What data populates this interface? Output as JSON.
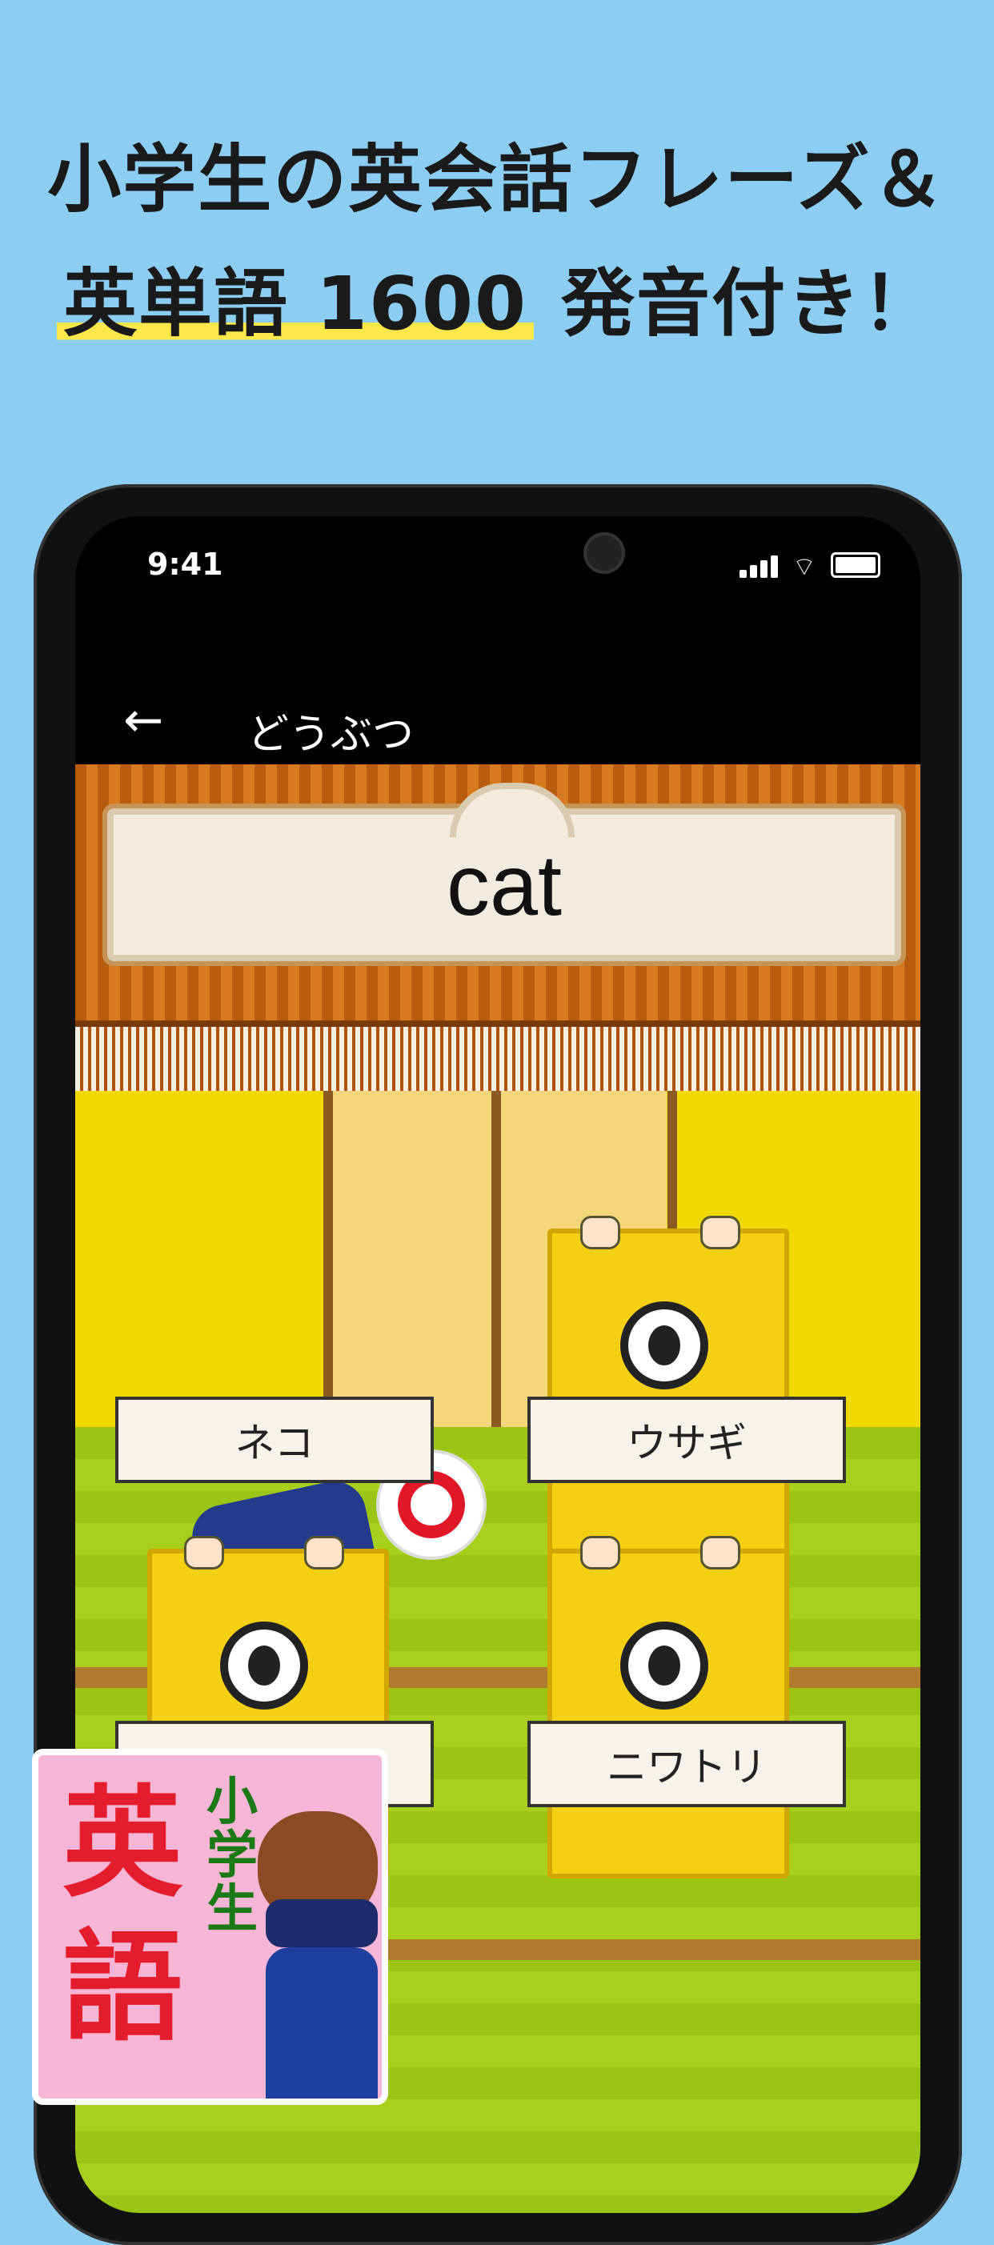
{
  "promo": {
    "line1": "小学生の英会話フレーズ＆",
    "line2_highlight": "英単語 1600",
    "line2_rest": " 発音付き！"
  },
  "status_bar": {
    "time": "9:41"
  },
  "appbar": {
    "title": "どうぶつ",
    "back_icon": "arrow-left"
  },
  "quiz": {
    "word": "cat",
    "choices": [
      "ネコ",
      "ウサギ",
      "",
      "ニワトリ"
    ],
    "result_mark": "○"
  },
  "app_icon": {
    "title_small": "小学生",
    "title_big": "英語"
  },
  "colors": {
    "background": "#8ccdf3",
    "highlight": "#ffe94a",
    "correct_mark": "#e01828"
  }
}
